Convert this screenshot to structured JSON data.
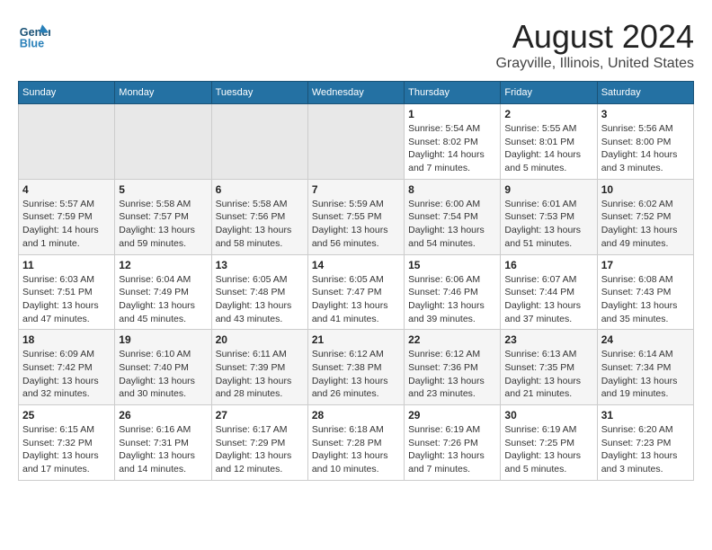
{
  "logo": {
    "line1": "General",
    "line2": "Blue"
  },
  "title": "August 2024",
  "subtitle": "Grayville, Illinois, United States",
  "days_of_week": [
    "Sunday",
    "Monday",
    "Tuesday",
    "Wednesday",
    "Thursday",
    "Friday",
    "Saturday"
  ],
  "weeks": [
    [
      {
        "day": "",
        "info": ""
      },
      {
        "day": "",
        "info": ""
      },
      {
        "day": "",
        "info": ""
      },
      {
        "day": "",
        "info": ""
      },
      {
        "day": "1",
        "info": "Sunrise: 5:54 AM\nSunset: 8:02 PM\nDaylight: 14 hours\nand 7 minutes."
      },
      {
        "day": "2",
        "info": "Sunrise: 5:55 AM\nSunset: 8:01 PM\nDaylight: 14 hours\nand 5 minutes."
      },
      {
        "day": "3",
        "info": "Sunrise: 5:56 AM\nSunset: 8:00 PM\nDaylight: 14 hours\nand 3 minutes."
      }
    ],
    [
      {
        "day": "4",
        "info": "Sunrise: 5:57 AM\nSunset: 7:59 PM\nDaylight: 14 hours\nand 1 minute."
      },
      {
        "day": "5",
        "info": "Sunrise: 5:58 AM\nSunset: 7:57 PM\nDaylight: 13 hours\nand 59 minutes."
      },
      {
        "day": "6",
        "info": "Sunrise: 5:58 AM\nSunset: 7:56 PM\nDaylight: 13 hours\nand 58 minutes."
      },
      {
        "day": "7",
        "info": "Sunrise: 5:59 AM\nSunset: 7:55 PM\nDaylight: 13 hours\nand 56 minutes."
      },
      {
        "day": "8",
        "info": "Sunrise: 6:00 AM\nSunset: 7:54 PM\nDaylight: 13 hours\nand 54 minutes."
      },
      {
        "day": "9",
        "info": "Sunrise: 6:01 AM\nSunset: 7:53 PM\nDaylight: 13 hours\nand 51 minutes."
      },
      {
        "day": "10",
        "info": "Sunrise: 6:02 AM\nSunset: 7:52 PM\nDaylight: 13 hours\nand 49 minutes."
      }
    ],
    [
      {
        "day": "11",
        "info": "Sunrise: 6:03 AM\nSunset: 7:51 PM\nDaylight: 13 hours\nand 47 minutes."
      },
      {
        "day": "12",
        "info": "Sunrise: 6:04 AM\nSunset: 7:49 PM\nDaylight: 13 hours\nand 45 minutes."
      },
      {
        "day": "13",
        "info": "Sunrise: 6:05 AM\nSunset: 7:48 PM\nDaylight: 13 hours\nand 43 minutes."
      },
      {
        "day": "14",
        "info": "Sunrise: 6:05 AM\nSunset: 7:47 PM\nDaylight: 13 hours\nand 41 minutes."
      },
      {
        "day": "15",
        "info": "Sunrise: 6:06 AM\nSunset: 7:46 PM\nDaylight: 13 hours\nand 39 minutes."
      },
      {
        "day": "16",
        "info": "Sunrise: 6:07 AM\nSunset: 7:44 PM\nDaylight: 13 hours\nand 37 minutes."
      },
      {
        "day": "17",
        "info": "Sunrise: 6:08 AM\nSunset: 7:43 PM\nDaylight: 13 hours\nand 35 minutes."
      }
    ],
    [
      {
        "day": "18",
        "info": "Sunrise: 6:09 AM\nSunset: 7:42 PM\nDaylight: 13 hours\nand 32 minutes."
      },
      {
        "day": "19",
        "info": "Sunrise: 6:10 AM\nSunset: 7:40 PM\nDaylight: 13 hours\nand 30 minutes."
      },
      {
        "day": "20",
        "info": "Sunrise: 6:11 AM\nSunset: 7:39 PM\nDaylight: 13 hours\nand 28 minutes."
      },
      {
        "day": "21",
        "info": "Sunrise: 6:12 AM\nSunset: 7:38 PM\nDaylight: 13 hours\nand 26 minutes."
      },
      {
        "day": "22",
        "info": "Sunrise: 6:12 AM\nSunset: 7:36 PM\nDaylight: 13 hours\nand 23 minutes."
      },
      {
        "day": "23",
        "info": "Sunrise: 6:13 AM\nSunset: 7:35 PM\nDaylight: 13 hours\nand 21 minutes."
      },
      {
        "day": "24",
        "info": "Sunrise: 6:14 AM\nSunset: 7:34 PM\nDaylight: 13 hours\nand 19 minutes."
      }
    ],
    [
      {
        "day": "25",
        "info": "Sunrise: 6:15 AM\nSunset: 7:32 PM\nDaylight: 13 hours\nand 17 minutes."
      },
      {
        "day": "26",
        "info": "Sunrise: 6:16 AM\nSunset: 7:31 PM\nDaylight: 13 hours\nand 14 minutes."
      },
      {
        "day": "27",
        "info": "Sunrise: 6:17 AM\nSunset: 7:29 PM\nDaylight: 13 hours\nand 12 minutes."
      },
      {
        "day": "28",
        "info": "Sunrise: 6:18 AM\nSunset: 7:28 PM\nDaylight: 13 hours\nand 10 minutes."
      },
      {
        "day": "29",
        "info": "Sunrise: 6:19 AM\nSunset: 7:26 PM\nDaylight: 13 hours\nand 7 minutes."
      },
      {
        "day": "30",
        "info": "Sunrise: 6:19 AM\nSunset: 7:25 PM\nDaylight: 13 hours\nand 5 minutes."
      },
      {
        "day": "31",
        "info": "Sunrise: 6:20 AM\nSunset: 7:23 PM\nDaylight: 13 hours\nand 3 minutes."
      }
    ]
  ]
}
